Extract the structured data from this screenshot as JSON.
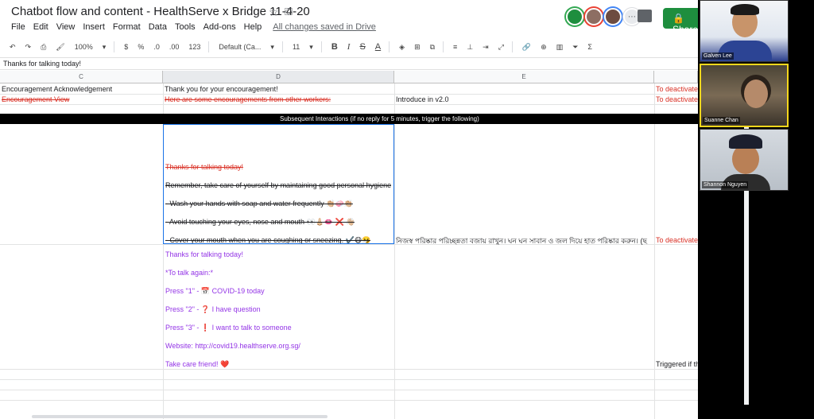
{
  "doc": {
    "title": "Chatbot flow and content - HealthServe x Bridge 11-4-20",
    "saved_status": "All changes saved in Drive",
    "share_label": "Share"
  },
  "menu": [
    "File",
    "Edit",
    "View",
    "Insert",
    "Format",
    "Data",
    "Tools",
    "Add-ons",
    "Help"
  ],
  "toolbar": {
    "zoom": "100%",
    "currency": "$",
    "percent": "%",
    "dec_less": ".0",
    "dec_more": ".00",
    "format_more": "123",
    "font": "Default (Ca...",
    "font_size": "11",
    "bold": "B",
    "italic": "I",
    "strike": "S",
    "text_color": "A",
    "functions": "Σ"
  },
  "formula_bar": "Thanks for talking today!",
  "columns": [
    "C",
    "D",
    "E"
  ],
  "rows": {
    "r1": {
      "c": "Encouragement Acknowledgement",
      "d": "Thank you for your encouragement!",
      "f": "To deactivate"
    },
    "r2": {
      "c": "Encouragement View",
      "d": "Here are some encouragements from other workers:",
      "e": "Introduce in v2.0",
      "f": "To deactivate"
    },
    "banner": "Subsequent Interactions (if no reply for 5 minutes, trigger the following)",
    "r3": {
      "d_lines": [
        "Thanks for talking today!",
        "Remember, take care of yourself by maintaining good personal hygiene",
        "- Wash your hands with soap and water frequently 👏🏼🧼👏🏼",
        "- Avoid touching your eyes, nose and mouth 👀👃🏼👄 ❌ 👋🏼",
        "- Cover your mouth when you are coughing or sneezing. ✔️😷🤧"
      ],
      "e": "নিজস্ব পরিষ্কার পরিচ্ছন্নতা বজায় রাখুন। ঘন ঘন সাবান ও জল দিয়ে হাত পরিষ্কার করুন। (ছ",
      "f": "To deactivate"
    },
    "r4": {
      "d_lines": [
        "Thanks for talking today!",
        "*To talk again:*",
        "Press \"1\" - 📅 COVID-19 today",
        "Press \"2\" - ❓ I have question",
        "Press \"3\" - ❗ I want to talk to someone",
        "Website: http://covid19.healthserve.org.sg/",
        "Take care friend! ❤️"
      ],
      "f": "Triggered if there is no resp"
    }
  },
  "participants": [
    {
      "name": "Galven Lee"
    },
    {
      "name": "Suanne Chan"
    },
    {
      "name": "Shannon Nguyen"
    }
  ],
  "colors": {
    "accent": "#1a73e8",
    "share_green": "#1e8e3e",
    "red_text": "#d93025",
    "purple_text": "#9334e6",
    "speaker_highlight": "#f9d71c"
  }
}
